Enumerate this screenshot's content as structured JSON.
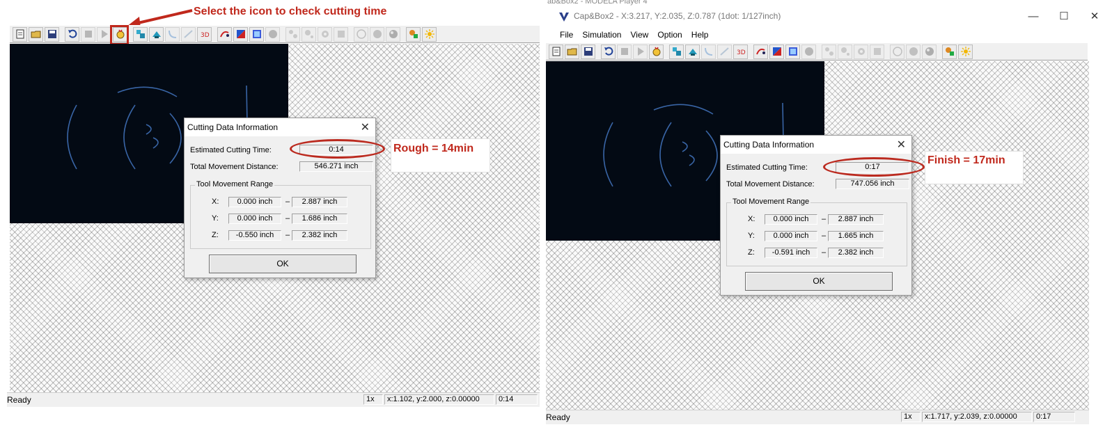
{
  "annotations": {
    "select_icon": "Select the icon to check cutting time",
    "rough": "Rough = 14min",
    "finish": "Finish = 17min",
    "accent_color": "#c0281c"
  },
  "window": {
    "prev_title_fragment": "ab&Box2 - MODELA Player 4",
    "title": "Cap&Box2 - X:3.217, Y:2.035, Z:0.787 (1dot: 1/127inch)",
    "menu": [
      "File",
      "Simulation",
      "View",
      "Option",
      "Help"
    ]
  },
  "left": {
    "dialog": {
      "title": "Cutting Data Information",
      "est_time_label": "Estimated Cutting Time:",
      "est_time": "0:14",
      "distance_label": "Total Movement Distance:",
      "distance": "546.271 inch",
      "range_label": "Tool Movement Range",
      "rows": [
        {
          "axis": "X:",
          "min": "0.000 inch",
          "sep": "–",
          "max": "2.887 inch"
        },
        {
          "axis": "Y:",
          "min": "0.000 inch",
          "sep": "–",
          "max": "1.686 inch"
        },
        {
          "axis": "Z:",
          "min": "-0.550 inch",
          "sep": "–",
          "max": "2.382 inch"
        }
      ],
      "ok": "OK"
    },
    "status": {
      "ready": "Ready",
      "zoom": "1x",
      "coords": "x:1.102, y:2.000, z:0.00000",
      "time": "0:14"
    }
  },
  "right": {
    "dialog": {
      "title": "Cutting Data Information",
      "est_time_label": "Estimated Cutting Time:",
      "est_time": "0:17",
      "distance_label": "Total Movement Distance:",
      "distance": "747.056 inch",
      "range_label": "Tool Movement Range",
      "rows": [
        {
          "axis": "X:",
          "min": "0.000 inch",
          "sep": "–",
          "max": "2.887 inch"
        },
        {
          "axis": "Y:",
          "min": "0.000 inch",
          "sep": "–",
          "max": "1.665 inch"
        },
        {
          "axis": "Z:",
          "min": "-0.591 inch",
          "sep": "–",
          "max": "2.382 inch"
        }
      ],
      "ok": "OK"
    },
    "status": {
      "ready": "Ready",
      "zoom": "1x",
      "coords": "x:1.717, y:2.039, z:0.00000",
      "time": "0:17"
    }
  },
  "toolbar_icons": [
    "new-file-icon",
    "open-folder-icon",
    "save-icon",
    "sep",
    "reload-icon",
    "stop-icon",
    "play-icon",
    "cutting-time-icon",
    "sep",
    "view-top-icon",
    "view-front-icon",
    "curve-icon",
    "line-icon",
    "3d-view-icon",
    "sep",
    "path-icon",
    "shade-icon",
    "grid-icon",
    "sphere-icon",
    "sep",
    "tool-1-icon",
    "tool-2-icon",
    "tool-3-icon",
    "tool-4-icon",
    "sep",
    "render-1-icon",
    "render-2-icon",
    "render-3-icon",
    "sep",
    "material-icon",
    "light-icon"
  ]
}
